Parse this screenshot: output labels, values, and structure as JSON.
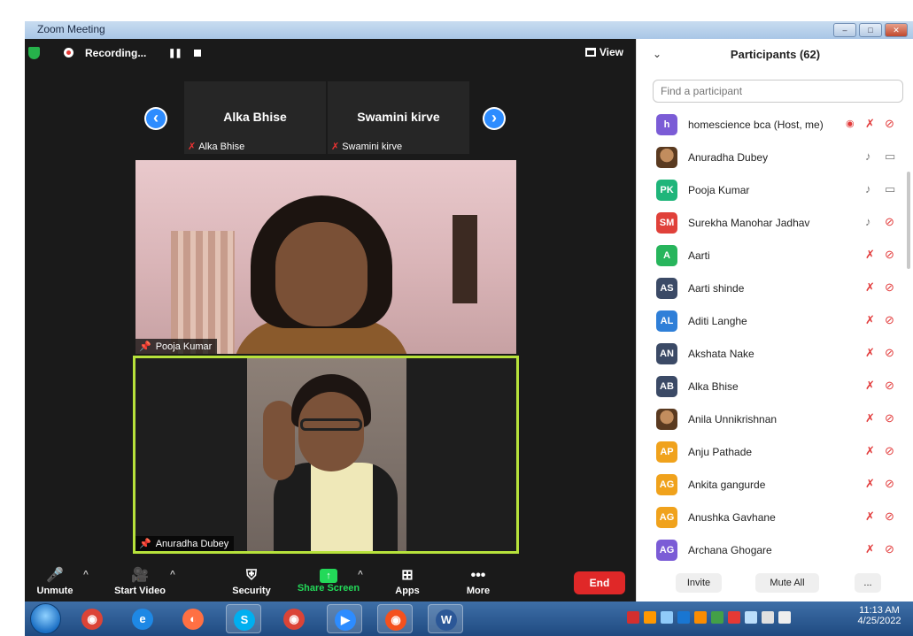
{
  "window": {
    "title": "Zoom Meeting",
    "buttons": [
      "–",
      "□",
      "✕"
    ]
  },
  "status_bar": {
    "recording_label": "Recording...",
    "pause_glyph": "❚❚",
    "view_label": "View"
  },
  "gallery": {
    "prev_glyph": "‹",
    "next_glyph": "›",
    "thumbs": [
      {
        "name": "Alka Bhise",
        "label": "Alka Bhise"
      },
      {
        "name": "Swamini kirve",
        "label": "Swamini kirve"
      }
    ]
  },
  "videos": [
    {
      "label": "Pooja Kumar"
    },
    {
      "label": "Anuradha Dubey"
    }
  ],
  "toolbar": {
    "unmute_label": "Unmute",
    "start_video_label": "Start Video",
    "security_label": "Security",
    "share_screen_label": "Share Screen",
    "apps_label": "Apps",
    "more_label": "More",
    "end_label": "End"
  },
  "participants": {
    "title": "Participants (62)",
    "search_placeholder": "Find a participant",
    "list": [
      {
        "initials": "h",
        "name": "homescience bca (Host, me)",
        "color": "#7b5cd6",
        "mic": "muted",
        "cam": "off",
        "host": true
      },
      {
        "initials": "",
        "name": "Anuradha Dubey",
        "color": "#8a5a2c",
        "mic": "on",
        "cam": "on",
        "photo": true
      },
      {
        "initials": "PK",
        "name": "Pooja Kumar",
        "color": "#1fb57a",
        "mic": "on",
        "cam": "on"
      },
      {
        "initials": "SM",
        "name": "Surekha Manohar Jadhav",
        "color": "#e0413a",
        "mic": "on",
        "cam": "off"
      },
      {
        "initials": "A",
        "name": "Aarti",
        "color": "#27b55c",
        "mic": "muted",
        "cam": "off"
      },
      {
        "initials": "AS",
        "name": "Aarti shinde",
        "color": "#3b4a66",
        "mic": "muted",
        "cam": "off"
      },
      {
        "initials": "AL",
        "name": "Aditi Langhe",
        "color": "#2f7fd8",
        "mic": "muted",
        "cam": "off"
      },
      {
        "initials": "AN",
        "name": "Akshata Nake",
        "color": "#3b4a66",
        "mic": "muted",
        "cam": "off"
      },
      {
        "initials": "AB",
        "name": "Alka Bhise",
        "color": "#3b4a66",
        "mic": "muted",
        "cam": "off"
      },
      {
        "initials": "",
        "name": "Anila Unnikrishnan",
        "color": "#6a8a3a",
        "mic": "muted",
        "cam": "off",
        "photo": true
      },
      {
        "initials": "AP",
        "name": "Anju Pathade",
        "color": "#f0a21c",
        "mic": "muted",
        "cam": "off"
      },
      {
        "initials": "AG",
        "name": "Ankita gangurde",
        "color": "#f0a21c",
        "mic": "muted",
        "cam": "off"
      },
      {
        "initials": "AG",
        "name": "Anushka Gavhane",
        "color": "#f0a21c",
        "mic": "muted",
        "cam": "off"
      },
      {
        "initials": "AG",
        "name": "Archana Ghogare",
        "color": "#7b5cd6",
        "mic": "muted",
        "cam": "off"
      }
    ],
    "invite_label": "Invite",
    "mute_all_label": "Mute All",
    "more_label": "..."
  },
  "taskbar": {
    "apps": [
      "chrome",
      "internet-explorer",
      "firefox",
      "skype",
      "chrome",
      "zoom",
      "google-chrome-profile",
      "word"
    ],
    "clock_time": "11:13 AM",
    "clock_date": "4/25/2022"
  }
}
